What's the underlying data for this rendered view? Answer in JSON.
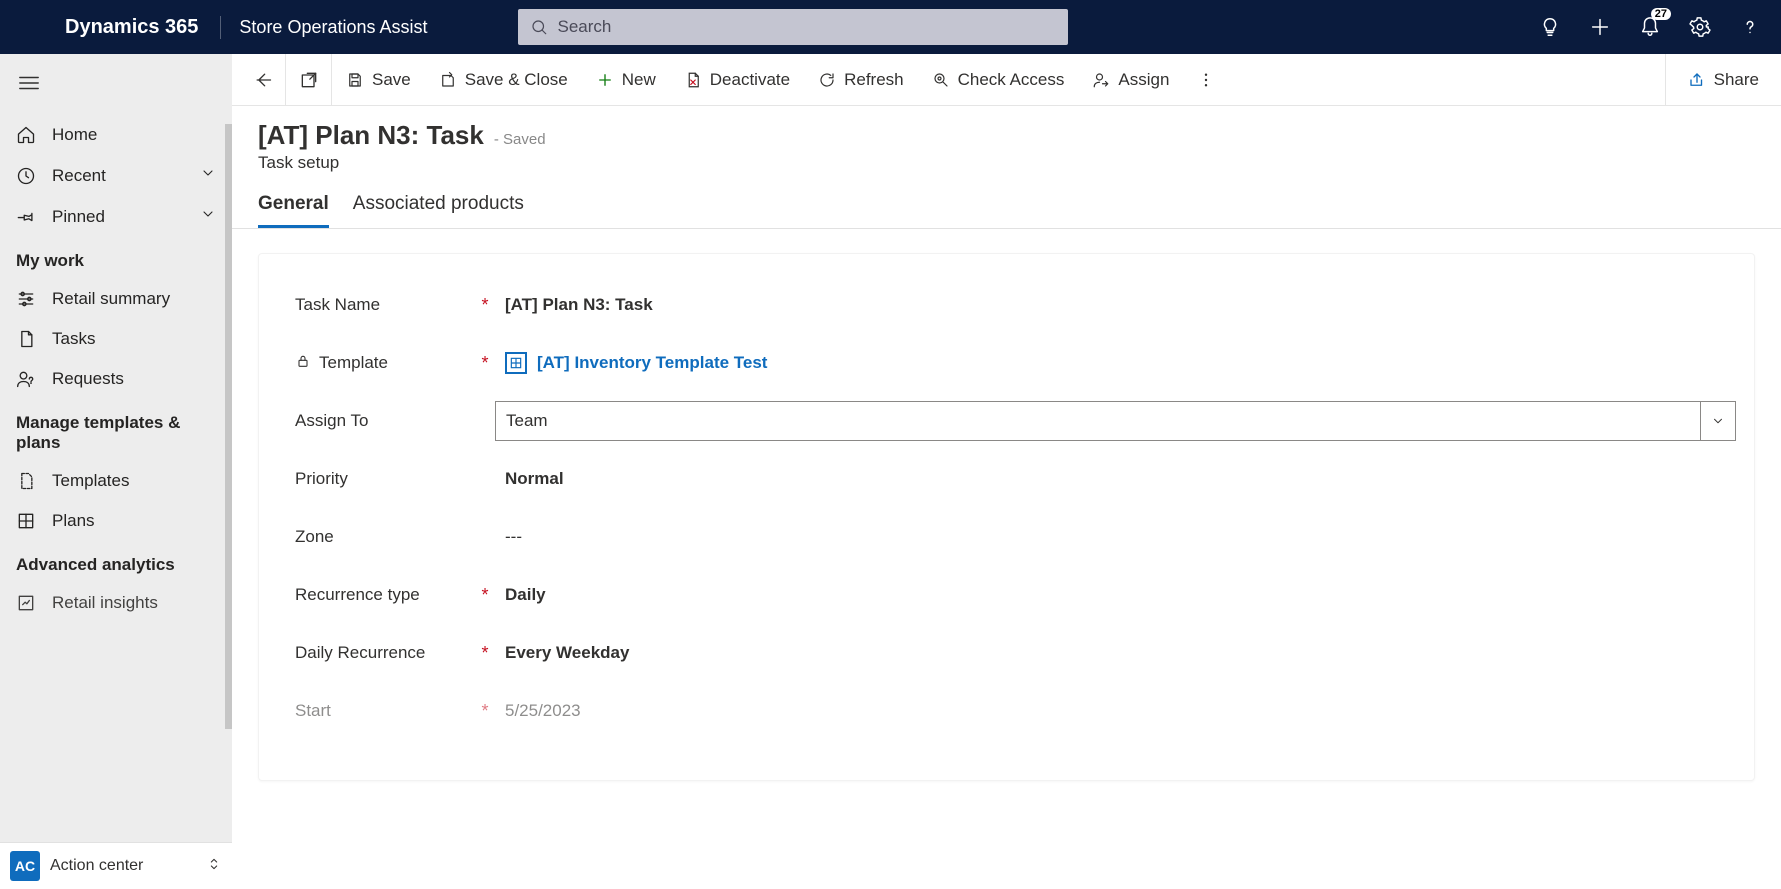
{
  "topbar": {
    "brand": "Dynamics 365",
    "app": "Store Operations Assist",
    "search_placeholder": "Search",
    "notification_count": "27"
  },
  "sidebar": {
    "home": "Home",
    "recent": "Recent",
    "pinned": "Pinned",
    "section_mywork": "My work",
    "retail_summary": "Retail summary",
    "tasks": "Tasks",
    "requests": "Requests",
    "section_manage": "Manage templates & plans",
    "templates": "Templates",
    "plans": "Plans",
    "section_analytics": "Advanced analytics",
    "retail_insights": "Retail insights",
    "action_center_badge": "AC",
    "action_center": "Action center"
  },
  "cmdbar": {
    "save": "Save",
    "save_close": "Save & Close",
    "new": "New",
    "deactivate": "Deactivate",
    "refresh": "Refresh",
    "check_access": "Check Access",
    "assign": "Assign",
    "share": "Share"
  },
  "record": {
    "title": "[AT] Plan N3: Task",
    "saved_state": "- Saved",
    "subtitle": "Task setup"
  },
  "tabs": {
    "general": "General",
    "associated_products": "Associated products"
  },
  "form": {
    "task_name_label": "Task Name",
    "task_name_value": "[AT] Plan N3: Task",
    "template_label": "Template",
    "template_value": "[AT] Inventory Template Test",
    "assign_to_label": "Assign To",
    "assign_to_value": "Team",
    "priority_label": "Priority",
    "priority_value": "Normal",
    "zone_label": "Zone",
    "zone_value": "---",
    "recurrence_type_label": "Recurrence type",
    "recurrence_type_value": "Daily",
    "daily_recurrence_label": "Daily Recurrence",
    "daily_recurrence_value": "Every Weekday",
    "start_label": "Start",
    "start_value": "5/25/2023"
  }
}
